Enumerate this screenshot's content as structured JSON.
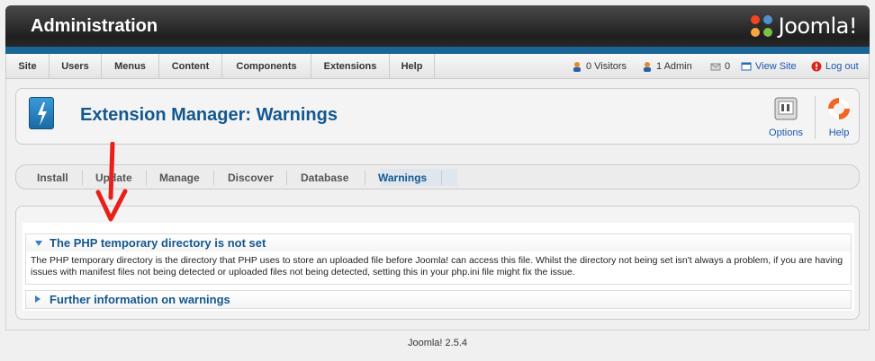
{
  "header": {
    "title": "Administration",
    "logo_text": "Joomla!"
  },
  "menu": {
    "items": [
      "Site",
      "Users",
      "Menus",
      "Content",
      "Components",
      "Extensions",
      "Help"
    ]
  },
  "status": {
    "visitors": "0 Visitors",
    "admins": "1 Admin",
    "messages": "0",
    "view_site": "View Site",
    "logout": "Log out"
  },
  "toolbar": {
    "title": "Extension Manager: Warnings",
    "options_label": "Options",
    "help_label": "Help"
  },
  "tabs": {
    "items": [
      "Install",
      "Update",
      "Manage",
      "Discover",
      "Database",
      "Warnings"
    ],
    "active": "Warnings"
  },
  "warnings": [
    {
      "title": "The PHP temporary directory is not set",
      "body": "The PHP temporary directory is the directory that PHP uses to store an uploaded file before Joomla! can access this file. Whilst the directory not being set isn't always a problem, if you are having issues with manifest files not being detected or uploaded files not being detected, setting this in your php.ini file might fix the issue.",
      "expanded": true
    },
    {
      "title": "Further information on warnings",
      "expanded": false
    }
  ],
  "footer": {
    "version": "Joomla! 2.5.4"
  },
  "colors": {
    "accent": "#14588f",
    "header_stripe": "#1a6596",
    "annotation": "#e8201a"
  }
}
